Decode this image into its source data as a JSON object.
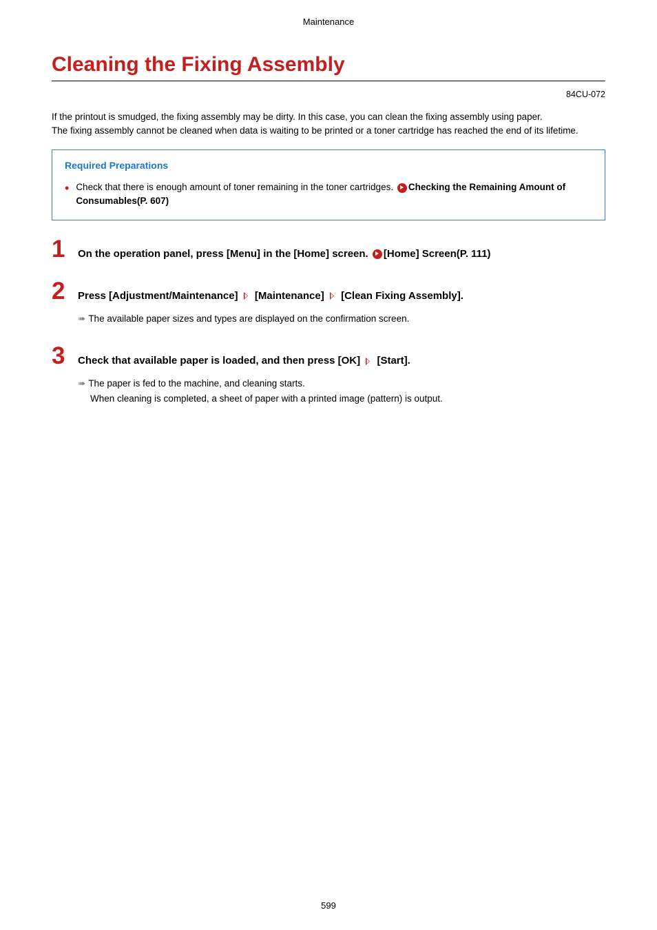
{
  "header": {
    "section_label": "Maintenance"
  },
  "title": "Cleaning the Fixing Assembly",
  "doc_code": "84CU-072",
  "intro": "If the printout is smudged, the fixing assembly may be dirty. In this case, you can clean the fixing assembly using paper.\nThe fixing assembly cannot be cleaned when data is waiting to be printed or a toner cartridge has reached the end of its lifetime.",
  "prep_box": {
    "title": "Required Preparations",
    "bullet_prefix": "Check that there is enough amount of toner remaining in the toner cartridges. ",
    "bullet_link": "Checking the Remaining Amount of Consumables(P. 607)"
  },
  "steps": [
    {
      "num": "1",
      "text_before_link": "On the operation panel, press [Menu] in the [Home] screen. ",
      "link_text": "[Home] Screen(P. 111)",
      "has_link": true,
      "parts": [],
      "sub_lines": []
    },
    {
      "num": "2",
      "text_before_link": "Press [Adjustment/Maintenance] ",
      "has_link": false,
      "parts": [
        " [Maintenance] ",
        " [Clean Fixing Assembly]."
      ],
      "sub_lines": [
        {
          "arrow": true,
          "text": "The available paper sizes and types are displayed on the confirmation screen."
        }
      ]
    },
    {
      "num": "3",
      "text_before_link": "Check that available paper is loaded, and then press [OK] ",
      "has_link": false,
      "parts": [
        " [Start]."
      ],
      "sub_lines": [
        {
          "arrow": true,
          "text": "The paper is fed to the machine, and cleaning starts."
        },
        {
          "arrow": false,
          "text": "When cleaning is completed, a sheet of paper with a printed image (pattern) is output."
        }
      ]
    }
  ],
  "page_number": "599"
}
